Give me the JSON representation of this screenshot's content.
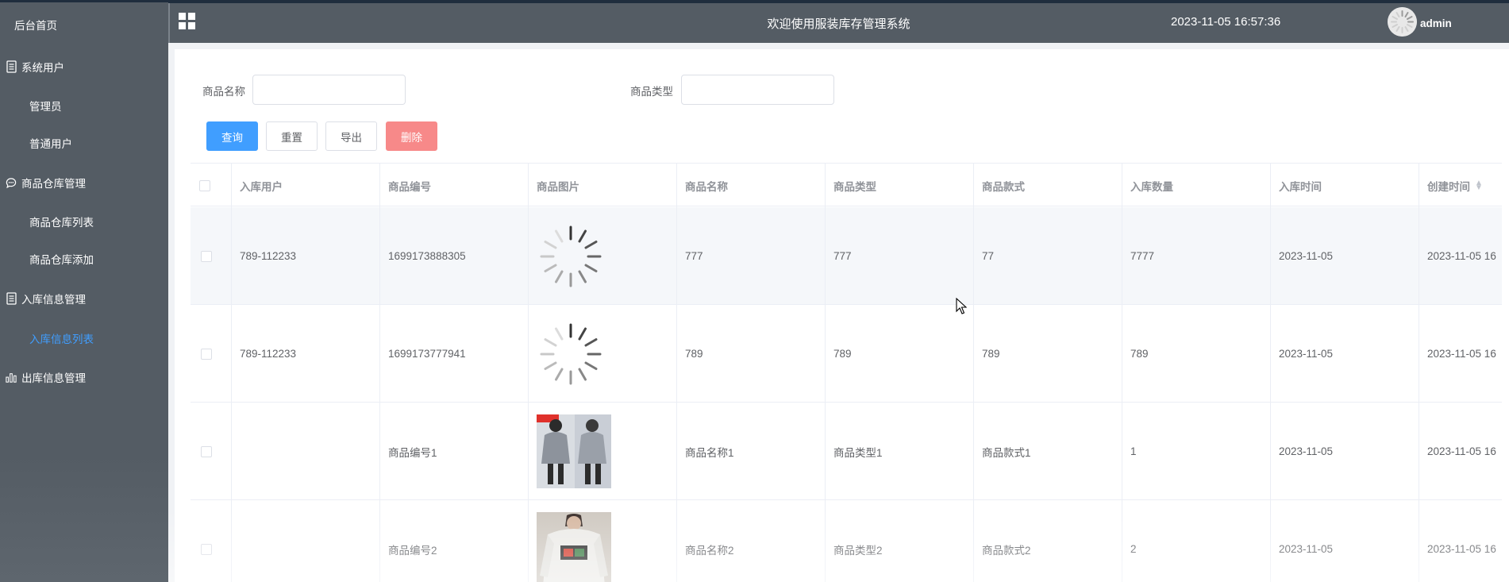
{
  "sidebar": {
    "home": "后台首页",
    "groups": [
      {
        "label": "系统用户",
        "icon": "document-icon"
      },
      {
        "label": "商品仓库管理",
        "icon": "chat-icon"
      },
      {
        "label": "入库信息管理",
        "icon": "document-icon"
      },
      {
        "label": "出库信息管理",
        "icon": "bar-chart-icon"
      }
    ],
    "items": [
      "管理员",
      "普通用户",
      "商品仓库列表",
      "商品仓库添加",
      "入库信息列表"
    ],
    "active_item": "入库信息列表",
    "active_color": "#409eff"
  },
  "header": {
    "title": "欢迎使用服装库存管理系统",
    "datetime": "2023-11-05 16:57:36",
    "username": "admin"
  },
  "search": {
    "name_label": "商品名称",
    "name_value": "",
    "type_label": "商品类型",
    "type_value": ""
  },
  "buttons": {
    "query": "查询",
    "reset": "重置",
    "export": "导出",
    "delete": "删除"
  },
  "colors": {
    "primary": "#409eff",
    "danger": "#f78989",
    "sidebar_bg": "#545c64"
  },
  "table": {
    "columns": [
      "入库用户",
      "商品编号",
      "商品图片",
      "商品名称",
      "商品类型",
      "商品款式",
      "入库数量",
      "入库时间",
      "创建时间"
    ],
    "rows": [
      {
        "user": "789-112233",
        "code": "1699173888305",
        "image": "loading-spinner-icon",
        "name": "777",
        "type": "777",
        "style": "77",
        "qty": "7777",
        "in_time": "2023-11-05",
        "created": "2023-11-05 16"
      },
      {
        "user": "789-112233",
        "code": "1699173777941",
        "image": "loading-spinner-icon",
        "name": "789",
        "type": "789",
        "style": "789",
        "qty": "789",
        "in_time": "2023-11-05",
        "created": "2023-11-05 16"
      },
      {
        "user": "",
        "code": "商品编号1",
        "image": "clothing-photo",
        "name": "商品名称1",
        "type": "商品类型1",
        "style": "商品款式1",
        "qty": "1",
        "in_time": "2023-11-05",
        "created": "2023-11-05 16"
      },
      {
        "user": "",
        "code": "商品编号2",
        "image": "clothing-photo",
        "name": "商品名称2",
        "type": "商品类型2",
        "style": "商品款式2",
        "qty": "2",
        "in_time": "2023-11-05",
        "created": "2023-11-05 16"
      }
    ]
  }
}
